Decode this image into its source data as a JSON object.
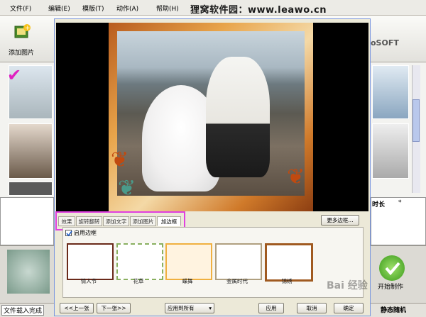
{
  "menu": [
    "文件(F)",
    "编辑(E)",
    "模版(T)",
    "动作(A)",
    "帮助(H)"
  ],
  "site_banner": "狸窝软件园：www.leawo.cn",
  "toolbar": {
    "add_image_label": "添加图片",
    "brand": "oSOFT"
  },
  "right_panel": {
    "time_header": "时长",
    "star_header": "*"
  },
  "right_action": "开始制作",
  "status": {
    "left_text": "文件载入完成",
    "right_text": "静态随机"
  },
  "dialog": {
    "tabs": [
      "效果",
      "旋转翻转",
      "添加文字",
      "添加图片",
      "加边框"
    ],
    "active_tab": "加边框",
    "more_frames_button": "更多边框...",
    "enable_frame_label": "启用边框",
    "frames": [
      "情人节",
      "花草",
      "蝶舞",
      "金属时代",
      "锦绣"
    ],
    "selected_frame": "蝶舞",
    "prev_button": "<<上一张",
    "next_button": "下一张>>",
    "apply_select": "应用到所有",
    "apply_button": "应用",
    "cancel_button": "取消",
    "ok_button": "确定"
  },
  "watermark": "Bai 经验",
  "colors": {
    "highlight": "#e040e0",
    "selected_frame_border": "#f0b040",
    "dialog_bg": "#ece9d8"
  }
}
